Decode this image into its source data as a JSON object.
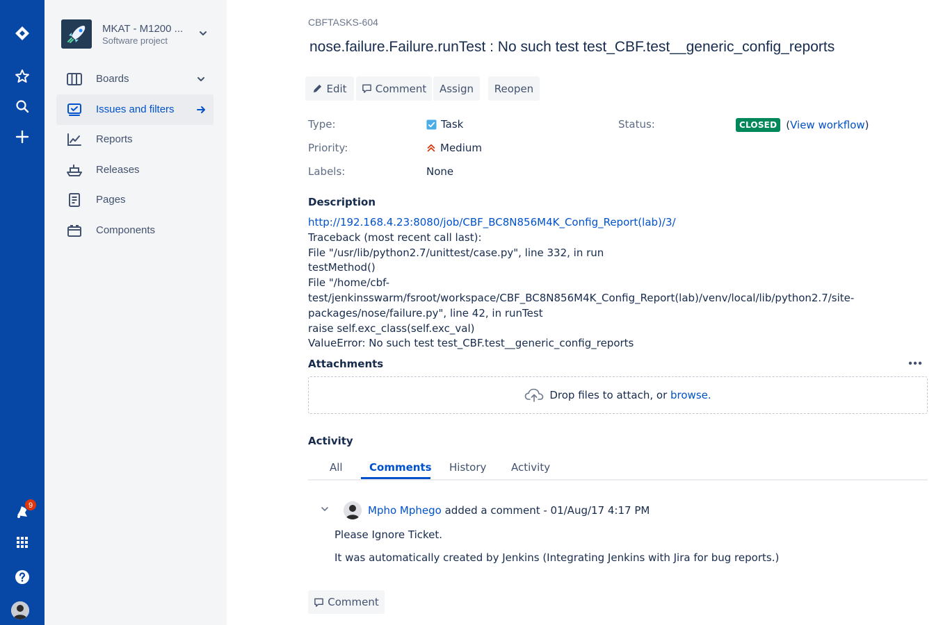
{
  "global_nav": {
    "notification_count": "9",
    "icons": [
      "jira-logo-icon",
      "star-icon",
      "search-icon",
      "plus-icon",
      "notifications-icon",
      "app-switcher-icon",
      "help-icon",
      "avatar"
    ]
  },
  "project": {
    "name": "MKAT - M1200 ...",
    "type": "Software project"
  },
  "sidebar": {
    "items": [
      {
        "label": "Boards",
        "icon": "board-icon"
      },
      {
        "label": "Issues and filters",
        "icon": "issues-icon",
        "active": true
      },
      {
        "label": "Reports",
        "icon": "reports-icon"
      },
      {
        "label": "Releases",
        "icon": "releases-icon"
      },
      {
        "label": "Pages",
        "icon": "pages-icon"
      },
      {
        "label": "Components",
        "icon": "components-icon"
      }
    ]
  },
  "issue": {
    "key": "CBFTASKS-604",
    "title": "nose.failure.Failure.runTest : No such test test_CBF.test__generic_config_reports"
  },
  "actions": {
    "edit": "Edit",
    "comment": "Comment",
    "assign": "Assign",
    "reopen": "Reopen"
  },
  "details": {
    "type_label": "Type:",
    "type_value": "Task",
    "priority_label": "Priority:",
    "priority_value": "Medium",
    "labels_label": "Labels:",
    "labels_value": "None",
    "status_label": "Status:",
    "status_value": "CLOSED",
    "view_workflow": "View workflow",
    "paren_open": "(",
    "paren_close": ")"
  },
  "description": {
    "heading": "Description",
    "link": "http://192.168.4.23:8080/job/CBF_BC8N856M4K_Config_Report(lab)/3/",
    "lines": [
      "Traceback (most recent call last):",
      "File \"/usr/lib/python2.7/unittest/case.py\", line 332, in run",
      "testMethod()",
      "File \"/home/cbf-test/jenkinsswarm/fsroot/workspace/CBF_BC8N856M4K_Config_Report(lab)/venv/local/lib/python2.7/site-packages/nose/failure.py\", line 42, in runTest",
      "raise self.exc_class(self.exc_val)",
      "ValueError: No such test test_CBF.test__generic_config_reports"
    ]
  },
  "attachments": {
    "heading": "Attachments",
    "drop_text": "Drop files to attach, or",
    "browse": "browse."
  },
  "activity": {
    "heading": "Activity",
    "tabs": [
      "All",
      "Comments",
      "History",
      "Activity"
    ],
    "active_tab": "Comments"
  },
  "comment": {
    "author": "Mpho Mphego",
    "meta": "added a comment - 01/Aug/17 4:17 PM",
    "body": [
      "Please Ignore Ticket.",
      "It was automatically created by Jenkins (Integrating Jenkins with Jira for bug reports.)"
    ]
  },
  "bottom": {
    "comment_button": "Comment"
  },
  "colors": {
    "global_nav": "#0747a6",
    "sidebar": "#f4f5f7",
    "link": "#0052cc",
    "status_closed": "#00875a",
    "badge": "#de350b"
  }
}
